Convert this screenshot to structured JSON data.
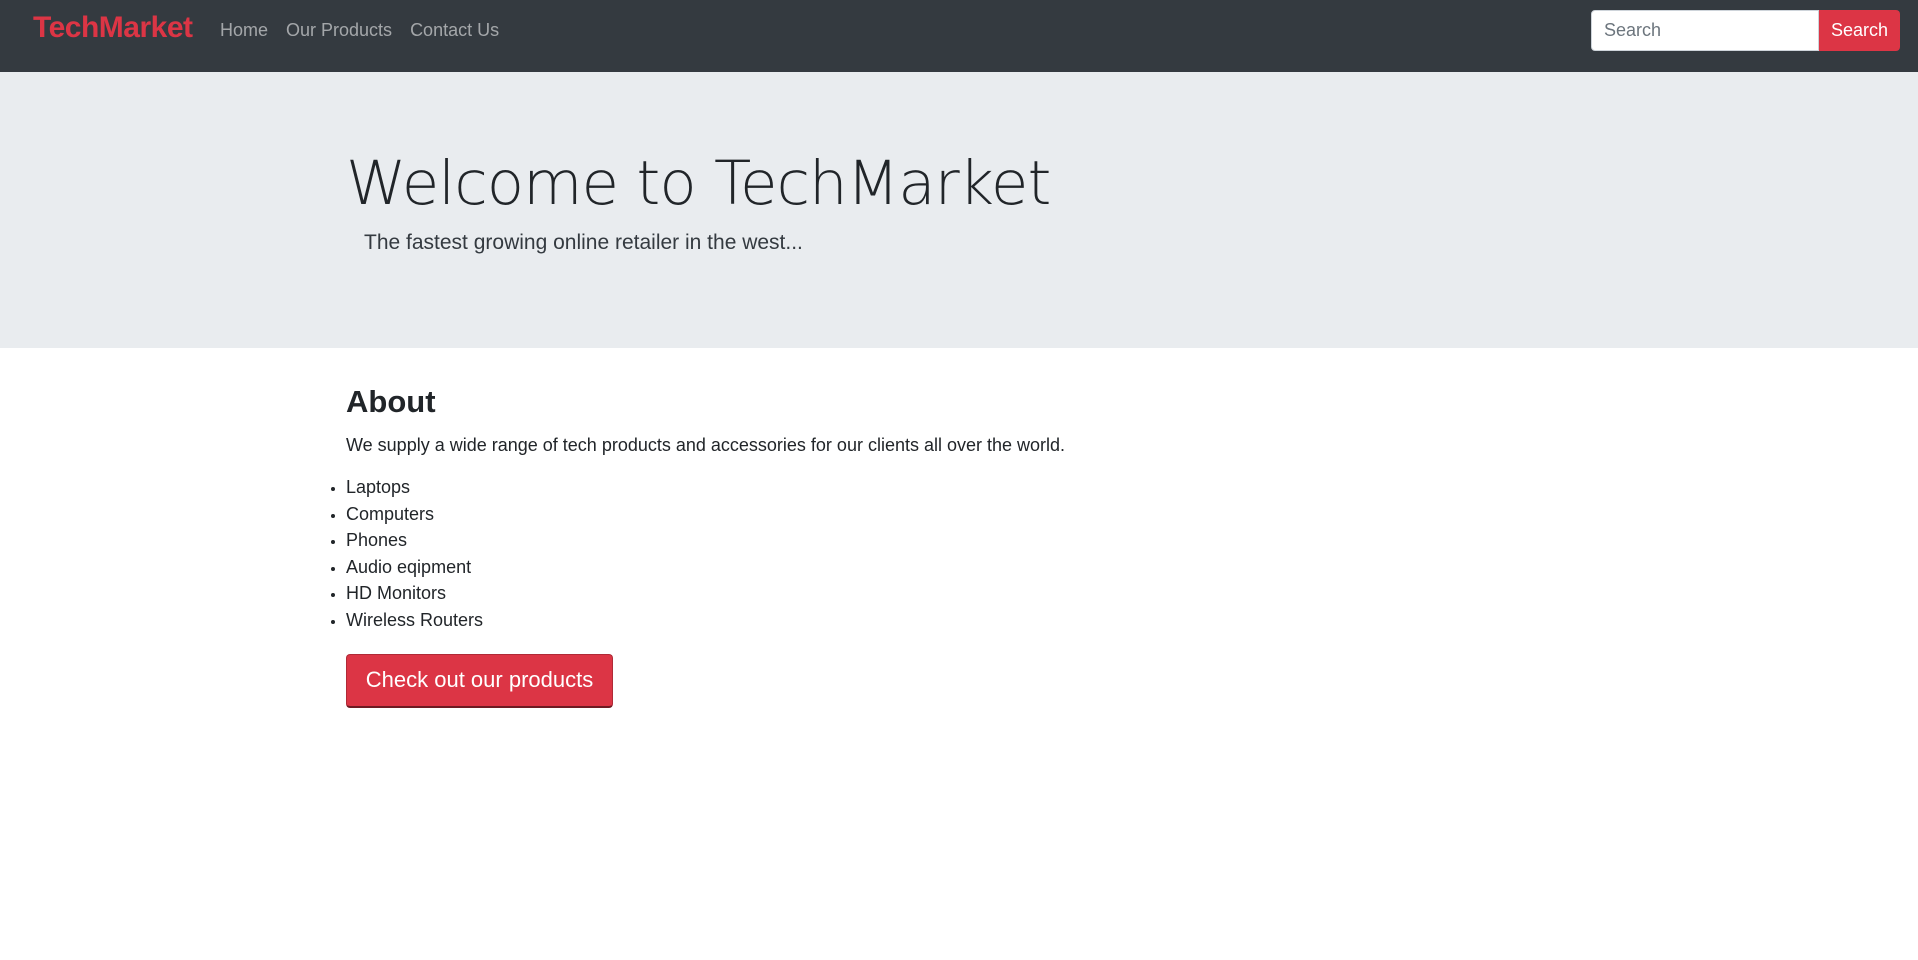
{
  "navbar": {
    "brand": "TechMarket",
    "links": [
      "Home",
      "Our Products",
      "Contact Us"
    ],
    "search": {
      "placeholder": "Search",
      "button_label": "Search"
    }
  },
  "hero": {
    "title": "Welcome to TechMarket",
    "subtitle": "The fastest growing online retailer in the west..."
  },
  "about": {
    "title": "About",
    "text": "We supply a wide range of tech products and accessories for our clients all over the world.",
    "products": [
      "Laptops",
      "Computers",
      "Phones",
      "Audio eqipment",
      "HD Monitors",
      "Wireless Routers"
    ],
    "cta_label": "Check out our products"
  },
  "colors": {
    "brand": "#dc3545",
    "navbar_bg": "#343a40",
    "hero_bg": "#e9ecef"
  }
}
